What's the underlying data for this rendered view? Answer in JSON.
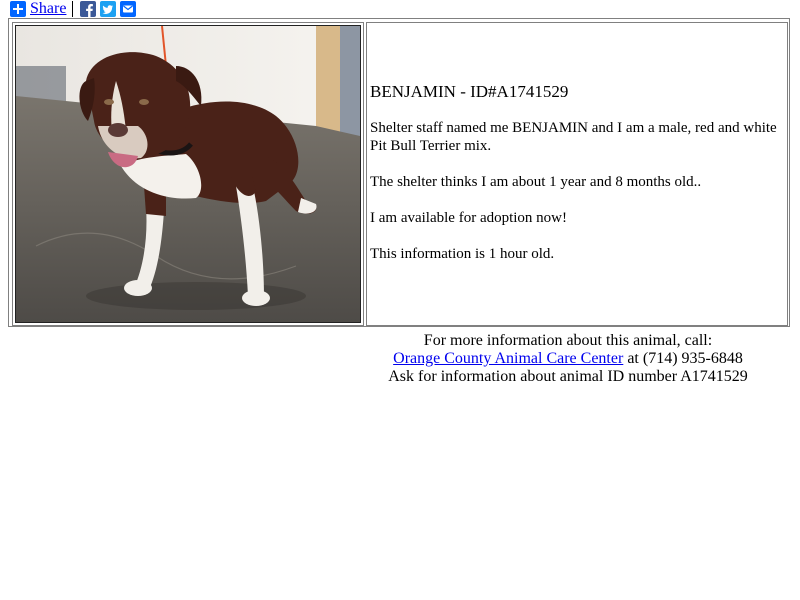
{
  "share": {
    "label": "Share",
    "icons": [
      "share-plus-icon",
      "facebook-icon",
      "twitter-icon",
      "email-icon"
    ]
  },
  "animal": {
    "title": "BENJAMIN - ID#A1741529",
    "description": "Shelter staff named me BENJAMIN and I am a male, red and white Pit Bull Terrier mix.",
    "age": "The shelter thinks I am about 1 year and 8 months old..",
    "availability": "I am available for adoption now!",
    "freshness": "This information is 1 hour old.",
    "photo_alt": "Photo of BENJAMIN, a brown and white Pit Bull Terrier mix"
  },
  "contact": {
    "intro": "For more information about this animal, call:",
    "shelter_name": "Orange County Animal Care Center",
    "phone_text": " at (714) 935-6848",
    "ask_text": "Ask for information about animal ID number A1741529"
  },
  "colors": {
    "link": "#0000ee",
    "facebook": "#3b5998",
    "twitter": "#1da1f2",
    "share": "#0166ff"
  }
}
